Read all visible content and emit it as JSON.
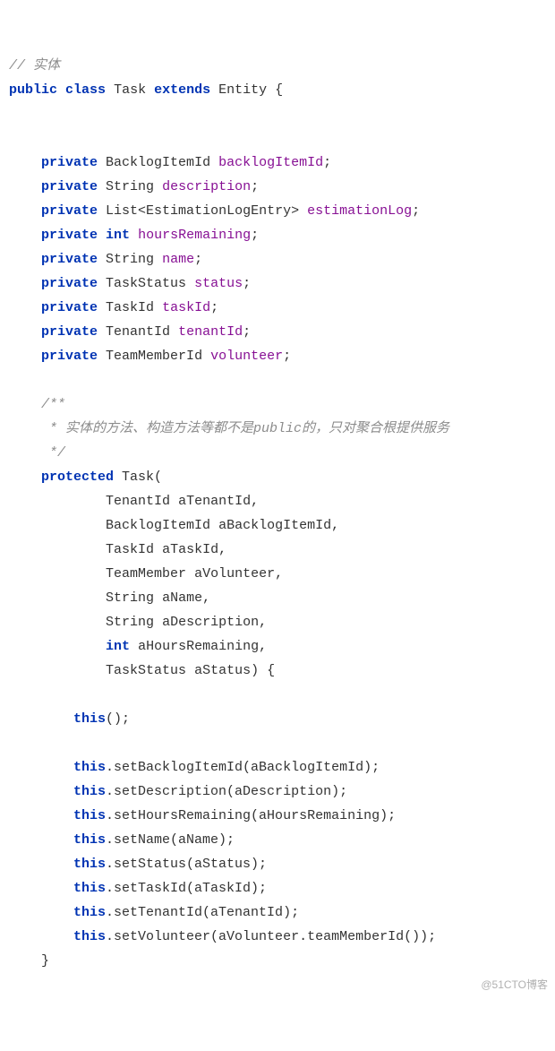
{
  "code": {
    "c0": "// 实体",
    "kw_public": "public",
    "kw_class": "class",
    "cls_name": "Task",
    "kw_extends": "extends",
    "super_name": "Entity",
    "brace_open": " {",
    "kw_private": "private",
    "kw_protected": "protected",
    "kw_int": "int",
    "kw_this": "this",
    "f1_type": "BacklogItemId",
    "f1_name": "backlogItemId",
    "f2_type": "String",
    "f2_name": "description",
    "f3_type": "List<EstimationLogEntry>",
    "f3_name": "estimationLog",
    "f4_name": "hoursRemaining",
    "f5_type": "String",
    "f5_name": "name",
    "f6_type": "TaskStatus",
    "f6_name": "status",
    "f7_type": "TaskId",
    "f7_name": "taskId",
    "f8_type": "TenantId",
    "f8_name": "tenantId",
    "f9_type": "TeamMemberId",
    "f9_name": "volunteer",
    "jd1": "/**",
    "jd2": " * 实体的方法、构造方法等都不是public的，只对聚合根提供服务",
    "jd3": " */",
    "ctor_name": "Task(",
    "p1_type": "TenantId",
    "p1_name": "aTenantId,",
    "p2_type": "BacklogItemId",
    "p2_name": "aBacklogItemId,",
    "p3_type": "TaskId",
    "p3_name": "aTaskId,",
    "p4_type": "TeamMember",
    "p4_name": "aVolunteer,",
    "p5_type": "String",
    "p5_name": "aName,",
    "p6_type": "String",
    "p6_name": "aDescription,",
    "p7_name": "aHoursRemaining,",
    "p8_type": "TaskStatus",
    "p8_name": "aStatus) {",
    "this_call": "();",
    "s1": ".setBacklogItemId(aBacklogItemId);",
    "s2": ".setDescription(aDescription);",
    "s3": ".setHoursRemaining(aHoursRemaining);",
    "s4": ".setName(aName);",
    "s5": ".setStatus(aStatus);",
    "s6": ".setTaskId(aTaskId);",
    "s7": ".setTenantId(aTenantId);",
    "s8": ".setVolunteer(aVolunteer.teamMemberId());",
    "brace_close": "}",
    "semi": ";"
  },
  "watermark": "@51CTO博客"
}
